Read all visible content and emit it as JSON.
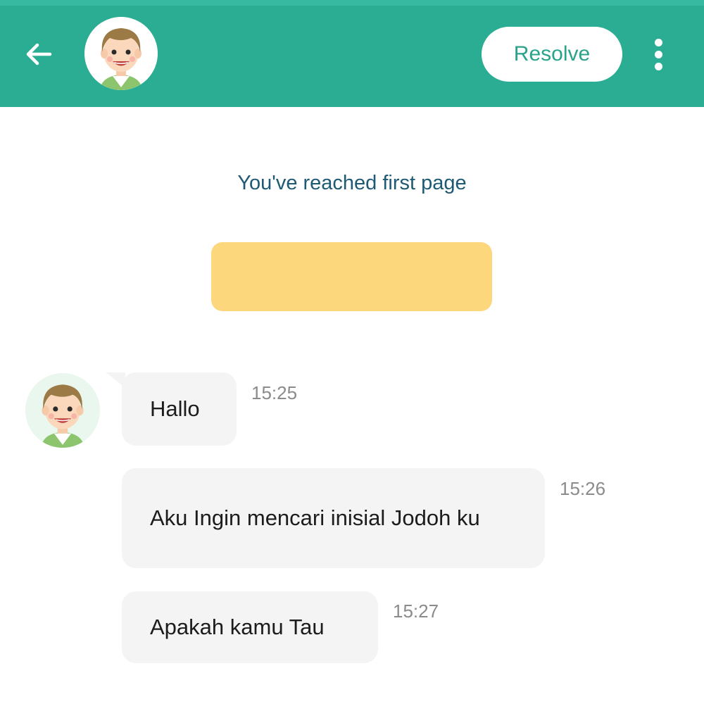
{
  "header": {
    "back_icon": "arrow-left-icon",
    "avatar": "user-avatar",
    "resolve_label": "Resolve",
    "more_icon": "vertical-dots-icon",
    "background": "#2aad92"
  },
  "chat": {
    "first_page_note": "You've reached first page",
    "banner_color": "#fdd77b",
    "messages": [
      {
        "text": "Hallo",
        "time": "15:25"
      },
      {
        "text": "Aku Ingin mencari inisial Jodoh ku",
        "time": "15:26"
      },
      {
        "text": "Apakah kamu Tau",
        "time": "15:27"
      }
    ]
  }
}
